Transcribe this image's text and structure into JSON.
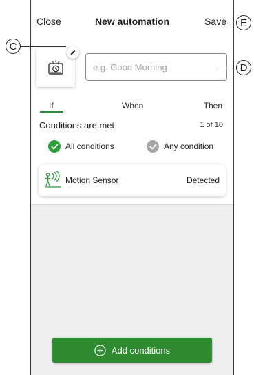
{
  "header": {
    "close_label": "Close",
    "title": "New automation",
    "save_label": "Save"
  },
  "name_input": {
    "value": "",
    "placeholder": "e.g. Good Morning"
  },
  "tabs": [
    {
      "label": "If",
      "active": true
    },
    {
      "label": "When",
      "active": false
    },
    {
      "label": "Then",
      "active": false
    }
  ],
  "conditions": {
    "title": "Conditions are met",
    "count": "1 of 10",
    "options": [
      {
        "label": "All conditions",
        "selected": true
      },
      {
        "label": "Any condition",
        "selected": false
      }
    ]
  },
  "condition_items": [
    {
      "icon": "motion-sensor-icon",
      "name": "Motion Sensor",
      "state": "Detected"
    }
  ],
  "add_button": {
    "label": "Add conditions"
  },
  "callouts": {
    "c": "C",
    "d": "D",
    "e": "E"
  },
  "colors": {
    "accent_green": "#2e8b2f",
    "check_green": "#2e9e3a",
    "inactive_grey": "#a6a6a6",
    "empty_area": "#efefef"
  }
}
